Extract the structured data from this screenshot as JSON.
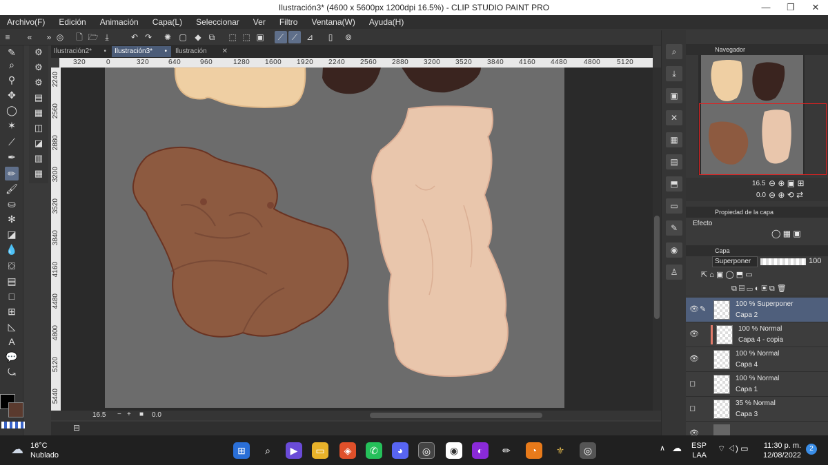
{
  "window": {
    "title": "Ilustración3* (4600 x 5600px 1200dpi 16.5%) - CLIP STUDIO PAINT PRO"
  },
  "menu": [
    "Archivo(F)",
    "Edición",
    "Animación",
    "Capa(L)",
    "Seleccionar",
    "Ver",
    "Filtro",
    "Ventana(W)",
    "Ayuda(H)"
  ],
  "tabs": [
    {
      "label": "Ilustración2*"
    },
    {
      "label": "Ilustración3*"
    },
    {
      "label": "Ilustración"
    }
  ],
  "ruler_h": [
    "320",
    "0",
    "320",
    "640",
    "960",
    "1280",
    "1600",
    "1920",
    "2240",
    "2560",
    "2880",
    "3200",
    "3520",
    "3840",
    "4160",
    "4480",
    "4800",
    "5120"
  ],
  "ruler_v": [
    "2240",
    "2560",
    "2880",
    "3200",
    "3520",
    "3840",
    "4160",
    "4480",
    "4800",
    "5120",
    "5440"
  ],
  "status": {
    "zoom": "16.5",
    "rotation": "0.0"
  },
  "navigator": {
    "title": "Navegador",
    "zoom": "16.5",
    "rotation": "0.0"
  },
  "layer_property": {
    "title": "Propiedad de la capa",
    "effect_label": "Efecto"
  },
  "layers_panel": {
    "title": "Capa",
    "blend_mode": "Superponer",
    "opacity": "100",
    "layers": [
      {
        "mode": "100 % Superponer",
        "name": "Capa 2",
        "selected": true
      },
      {
        "mode": "100 % Normal",
        "name": "Capa 4 - copia",
        "selected": false
      },
      {
        "mode": "100 % Normal",
        "name": "Capa 4",
        "selected": false
      },
      {
        "mode": "100 % Normal",
        "name": "Capa 1",
        "selected": false
      },
      {
        "mode": "35 % Normal",
        "name": "Capa 3",
        "selected": false
      }
    ]
  },
  "taskbar": {
    "temp": "16°C",
    "weather": "Nublado",
    "lang": "ESP",
    "region": "LAA",
    "time": "11:30 p. m.",
    "date": "12/08/2022",
    "notifications": "2"
  },
  "colors": {
    "accent": "#5f6f8a",
    "skin_light": "#efcfa3",
    "skin_dark": "#3a241f",
    "skin_brown": "#8d5a40",
    "skin_pink": "#e9c6ac"
  }
}
